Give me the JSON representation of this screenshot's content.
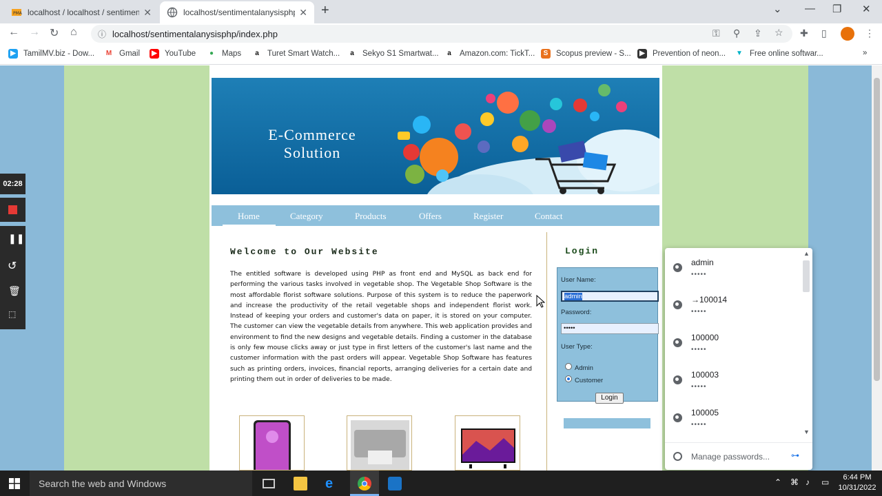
{
  "browser": {
    "tabs": [
      {
        "title": "localhost / localhost / sentimenta",
        "active": false
      },
      {
        "title": "localhost/sentimentalanysisphp/i",
        "active": true
      }
    ],
    "url": "localhost/sentimentalanysisphp/index.php",
    "bookmarks": [
      {
        "label": "TamilMV.biz - Dow...",
        "icon": "tamilmv-icon",
        "color": "#1da1f2"
      },
      {
        "label": "Gmail",
        "icon": "gmail-icon",
        "color": "#ea4335"
      },
      {
        "label": "YouTube",
        "icon": "youtube-icon",
        "color": "#ff0000"
      },
      {
        "label": "Maps",
        "icon": "maps-icon",
        "color": "#34a853"
      },
      {
        "label": "Turet Smart Watch...",
        "icon": "amazon-icon",
        "color": "#111111"
      },
      {
        "label": "Sekyo S1 Smartwat...",
        "icon": "amazon-icon",
        "color": "#111111"
      },
      {
        "label": "Amazon.com: TickT...",
        "icon": "amazon-icon",
        "color": "#111111"
      },
      {
        "label": "Scopus preview - S...",
        "icon": "scopus-icon",
        "color": "#e9711c"
      },
      {
        "label": "Prevention of neon...",
        "icon": "bookmark-icon",
        "color": "#333333"
      },
      {
        "label": "Free online softwar...",
        "icon": "software-icon",
        "color": "#00b3c8"
      }
    ]
  },
  "page": {
    "banner_title_line1": "E-Commerce",
    "banner_title_line2": "Solution",
    "nav": [
      "Home",
      "Category",
      "Products",
      "Offers",
      "Register",
      "Contact"
    ],
    "welcome_title": "Welcome to Our Website",
    "welcome_text": "The entitled software is developed using PHP as front end and MySQL as back end for performing the various tasks involved in vegetable shop. The Vegetable Shop Software is the most affordable florist software solutions. Purpose of this system is to reduce the paperwork and increase the productivity of the retail vegetable shops and independent florist work. Instead of keeping your orders and customer's data on paper, it is stored on your computer. The customer can view the vegetable details from anywhere. This web application provides and environment to find the new designs and vegetable details. Finding a customer in the database is only few mouse clicks away or just type in first letters of the customer's last name and the customer information with the past orders will appear. Vegetable Shop Software has features such as printing orders, invoices, financial reports, arranging deliveries for a certain date and printing them out in order of deliveries to be made.",
    "login": {
      "title": "Login",
      "username_label": "User Name:",
      "username_value": "admin",
      "password_label": "Password:",
      "password_mask": "•••••",
      "usertype_label": "User Type:",
      "options": [
        "Admin",
        "Customer"
      ],
      "selected": "Customer",
      "button": "Login"
    }
  },
  "password_popup": {
    "entries": [
      {
        "user": "admin",
        "mask": "•••••"
      },
      {
        "user": "→100014",
        "mask": "•••••"
      },
      {
        "user": "100000",
        "mask": "•••••"
      },
      {
        "user": "100003",
        "mask": "•••••"
      },
      {
        "user": "100005",
        "mask": "•••••"
      }
    ],
    "manage_label": "Manage passwords..."
  },
  "recorder": {
    "time": "02:28"
  },
  "taskbar": {
    "search_placeholder": "Search the web and Windows",
    "time": "6:44 PM",
    "date": "10/31/2022"
  }
}
